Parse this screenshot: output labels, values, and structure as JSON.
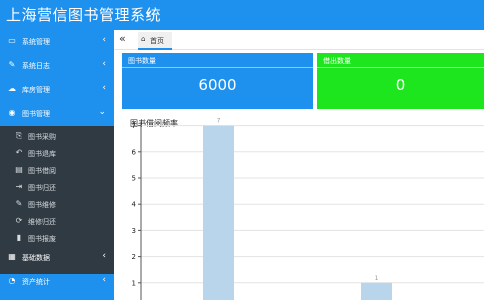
{
  "header": {
    "title": "上海营信图书管理系统",
    "collapse_glyph": "‹"
  },
  "sidebar": {
    "items": [
      {
        "label": "系统管理",
        "icon": "▭",
        "arrow": "‹"
      },
      {
        "label": "系统日志",
        "icon": "✎",
        "arrow": "‹"
      },
      {
        "label": "库房管理",
        "icon": "☁",
        "arrow": "‹"
      },
      {
        "label": "图书管理",
        "icon": "◉",
        "arrow": "⌄"
      },
      {
        "label": "基础数据",
        "icon": "▦",
        "arrow": "‹"
      },
      {
        "label": "资产统计",
        "icon": "◔",
        "arrow": "‹"
      }
    ],
    "book_submenu": [
      {
        "label": "图书采购",
        "icon": "⎘"
      },
      {
        "label": "图书退库",
        "icon": "↶"
      },
      {
        "label": "图书借阅",
        "icon": "▤"
      },
      {
        "label": "图书归还",
        "icon": "⇥"
      },
      {
        "label": "图书维修",
        "icon": "✎"
      },
      {
        "label": "维修归还",
        "icon": "⟳"
      },
      {
        "label": "图书报废",
        "icon": "▮"
      }
    ]
  },
  "tabs": {
    "back_glyph": "«",
    "home_icon": "⌂",
    "home_label": "首页"
  },
  "cards": [
    {
      "label": "图书数量",
      "value": "6000",
      "color": "#1e90ee"
    },
    {
      "label": "借出数量",
      "value": "0",
      "color": "#1ee61e"
    }
  ],
  "chart_data": {
    "type": "bar",
    "title": "图书借阅频率",
    "y_ticks": [
      "1",
      "2",
      "3",
      "4",
      "5",
      "6",
      "7"
    ],
    "ylim": [
      0,
      7
    ],
    "values": [
      7,
      1
    ],
    "data_labels": [
      "7",
      "1"
    ],
    "bar_color": "#b8d5ec",
    "grid": true
  }
}
